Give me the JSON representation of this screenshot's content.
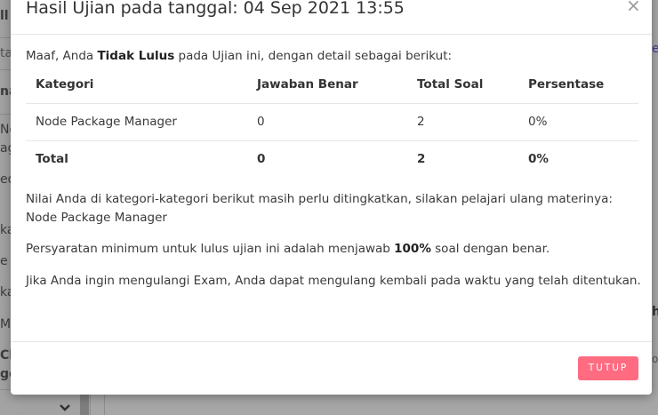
{
  "background": {
    "sidebar_fragments": [
      "ll",
      "ta",
      "na",
      "No",
      "ag",
      "ed",
      "ka",
      "e",
      "ka",
      "Ma",
      "Ch",
      "ge"
    ],
    "right_fragments": [
      "e",
      "h",
      "o"
    ]
  },
  "modal": {
    "title": "Hasil Ujian pada tanggal: 04 Sep 2021 13:55",
    "close_label": "×",
    "intro": {
      "prefix": "Maaf, Anda ",
      "status": "Tidak Lulus",
      "suffix": " pada Ujian ini, dengan detail sebagai berikut:"
    },
    "table": {
      "headers": [
        "Kategori",
        "Jawaban Benar",
        "Total Soal",
        "Persentase"
      ],
      "rows": [
        [
          "Node Package Manager",
          "0",
          "2",
          "0%"
        ]
      ],
      "total": [
        "Total",
        "0",
        "2",
        "0%"
      ]
    },
    "paragraphs": {
      "weak_categories": "Nilai Anda di kategori-kategori berikut masih perlu ditingkatkan, silakan pelajari ulang materinya: Node Package Manager",
      "requirement_prefix": "Persyaratan minimum untuk lulus ujian ini adalah menjawab ",
      "requirement_value": "100%",
      "requirement_suffix": " soal dengan benar.",
      "retake": "Jika Anda ingin mengulangi Exam, Anda dapat mengulang kembali pada waktu yang telah ditentukan."
    },
    "footer": {
      "close_button": "TUTUP"
    }
  },
  "colors": {
    "accent": "#ff6b81",
    "backdrop": "#a7a7a7"
  }
}
